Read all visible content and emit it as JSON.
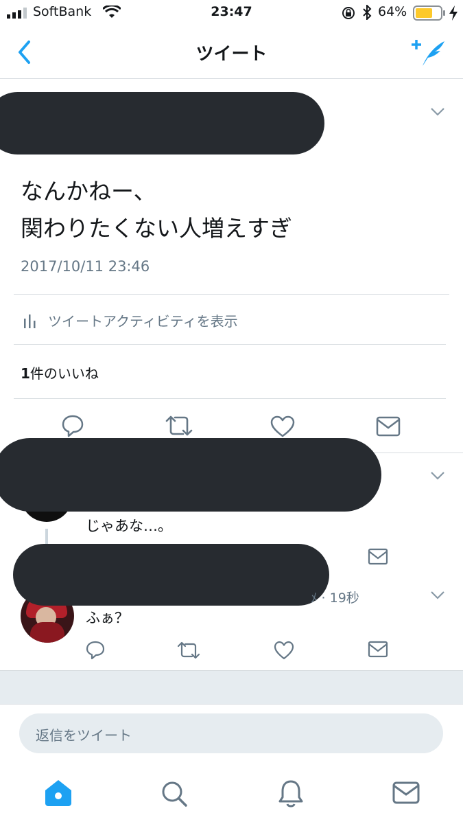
{
  "status_bar": {
    "carrier": "SoftBank",
    "time": "23:47",
    "battery_percent": "64%"
  },
  "nav": {
    "title": "ツイート"
  },
  "tweet": {
    "text_line1": "なんかねー、",
    "text_line2": "関わりたくない人増えすぎ",
    "timestamp": "2017/10/11 23:46",
    "activity_label": "ツイートアクティビティを表示",
    "likes_count": "1",
    "likes_label": "件のいいね"
  },
  "replies": [
    {
      "text": "じゃあな…。"
    },
    {
      "meta": "ﾒ · 19秒",
      "text": "ふぁ？"
    }
  ],
  "reply_box": {
    "placeholder": "返信をツイート"
  },
  "colors": {
    "accent": "#1da1f2",
    "text_primary": "#14171a",
    "text_secondary": "#657786",
    "redaction": "#272b30",
    "battery": "#fdc92b"
  }
}
